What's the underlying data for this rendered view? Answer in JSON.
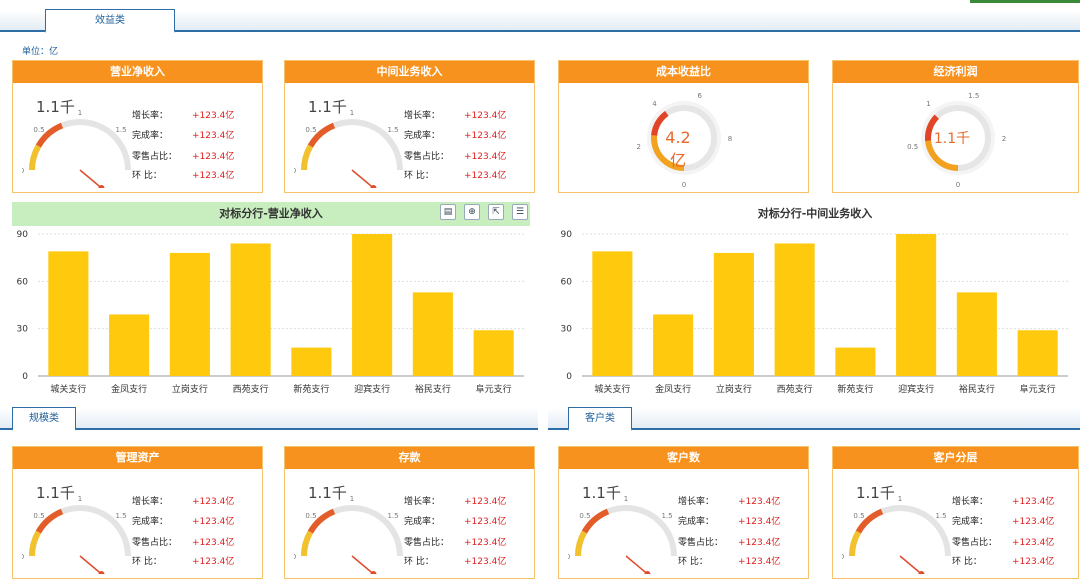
{
  "sections": {
    "efficiency": "效益类",
    "scale": "规模类",
    "customer": "客户类"
  },
  "unit": "单位：亿",
  "stat_labels": {
    "growth": "增长率：",
    "completion": "完成率：",
    "retail": "零售占比：",
    "mom": "环 比："
  },
  "stat_value": "+123.4亿",
  "gauge_ticks": {
    "a": [
      "0",
      "0.5",
      "1",
      "1.5",
      "2"
    ],
    "b": [
      "0",
      "2",
      "4",
      "6",
      "8"
    ]
  },
  "cards": {
    "c1": {
      "title": "营业净收入",
      "value": "1.1千"
    },
    "c2": {
      "title": "中间业务收入",
      "value": "1.1千"
    },
    "c3": {
      "title": "成本收益比",
      "value": "4.2亿"
    },
    "c4": {
      "title": "经济利润",
      "value": "1.1千"
    },
    "c5": {
      "title": "管理资产",
      "value": "1.1千"
    },
    "c6": {
      "title": "存款",
      "value": "1.1千"
    },
    "c7": {
      "title": "客户数",
      "value": "1.1千"
    },
    "c8": {
      "title": "客户分层",
      "value": "1.1千"
    }
  },
  "colors": {
    "bar": "#ffc90e",
    "header": "#f8921e",
    "accent": "#2e6ea6",
    "red": "#e02020"
  },
  "toolbar_icons": [
    "chart-type-icon",
    "zoom-icon",
    "select-icon",
    "list-icon"
  ],
  "chart_data": [
    {
      "type": "bar",
      "title": "对标分行-营业净收入",
      "categories": [
        "城关支行",
        "金凤支行",
        "立岗支行",
        "西苑支行",
        "新苑支行",
        "迎宾支行",
        "裕民支行",
        "阜元支行"
      ],
      "values": [
        79,
        39,
        78,
        84,
        18,
        90,
        53,
        29
      ],
      "ylim": [
        0,
        90
      ],
      "yticks": [
        0,
        30,
        60,
        90
      ],
      "grid": true
    },
    {
      "type": "bar",
      "title": "对标分行-中间业务收入",
      "categories": [
        "城关支行",
        "金凤支行",
        "立岗支行",
        "西苑支行",
        "新苑支行",
        "迎宾支行",
        "裕民支行",
        "阜元支行"
      ],
      "values": [
        79,
        39,
        78,
        84,
        18,
        90,
        53,
        29
      ],
      "ylim": [
        0,
        90
      ],
      "yticks": [
        0,
        30,
        60,
        90
      ],
      "grid": true
    }
  ]
}
